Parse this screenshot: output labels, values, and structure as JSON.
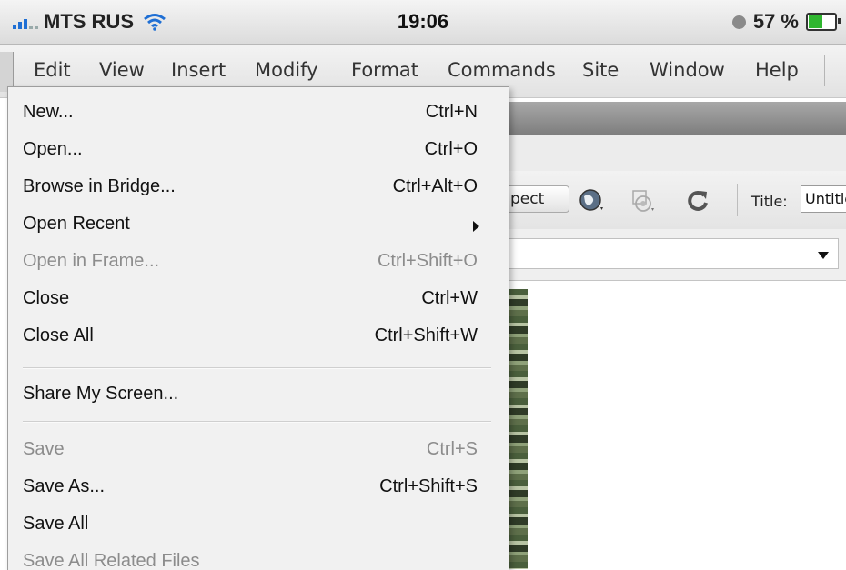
{
  "status_bar": {
    "carrier": "MTS RUS",
    "time": "19:06",
    "battery": "57 %",
    "battery_level": 0.57
  },
  "menubar": {
    "items": [
      "Edit",
      "View",
      "Insert",
      "Modify",
      "Format",
      "Commands",
      "Site",
      "Window",
      "Help"
    ]
  },
  "toolbar": {
    "inspect_label": "pect",
    "title_label": "Title:",
    "title_value": "Untitled"
  },
  "file_menu": {
    "items": [
      {
        "label": "New...",
        "shortcut": "Ctrl+N",
        "enabled": true
      },
      {
        "label": "Open...",
        "shortcut": "Ctrl+O",
        "enabled": true
      },
      {
        "label": "Browse in Bridge...",
        "shortcut": "Ctrl+Alt+O",
        "enabled": true
      },
      {
        "label": "Open Recent",
        "shortcut": "",
        "enabled": true,
        "submenu": true
      },
      {
        "label": "Open in Frame...",
        "shortcut": "Ctrl+Shift+O",
        "enabled": false
      },
      {
        "label": "Close",
        "shortcut": "Ctrl+W",
        "enabled": true
      },
      {
        "label": "Close All",
        "shortcut": "Ctrl+Shift+W",
        "enabled": true
      },
      {
        "label": "Share My Screen...",
        "shortcut": "",
        "enabled": true
      },
      {
        "label": "Save",
        "shortcut": "Ctrl+S",
        "enabled": false
      },
      {
        "label": "Save As...",
        "shortcut": "Ctrl+Shift+S",
        "enabled": true
      },
      {
        "label": "Save All",
        "shortcut": "",
        "enabled": true
      },
      {
        "label": "Save All Related Files",
        "shortcut": "",
        "enabled": false
      }
    ]
  },
  "colors": {
    "signal": "#1f6fd4",
    "battery_fill": "#2fb62f",
    "disabled_text": "#8c8c8c"
  }
}
